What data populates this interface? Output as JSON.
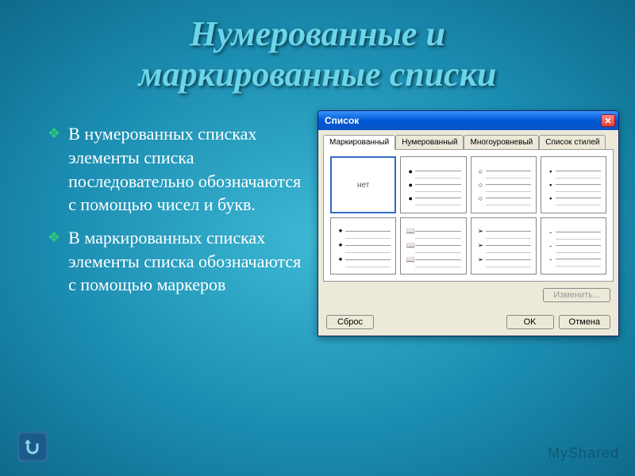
{
  "title_line1": "Нумерованные и",
  "title_line2": "маркированные списки",
  "bullets": [
    "В нумерованных списках элементы списка последовательно обозначаются с помощью чисел и букв.",
    "В маркированных списках элементы списка обозначаются с помощью маркеров"
  ],
  "dialog": {
    "title": "Список",
    "tabs": [
      "Маркированный",
      "Нумерованный",
      "Многоуровневый",
      "Список стилей"
    ],
    "active_tab": 0,
    "none_label": "нет",
    "cells": [
      {
        "type": "none"
      },
      {
        "type": "mark",
        "char": "●"
      },
      {
        "type": "mark",
        "char": "○"
      },
      {
        "type": "mark",
        "char": "▪"
      },
      {
        "type": "mark",
        "char": "✦"
      },
      {
        "type": "mark",
        "char": "📖"
      },
      {
        "type": "mark",
        "char": "➢"
      },
      {
        "type": "mark",
        "char": "-"
      }
    ],
    "buttons": {
      "change": "Изменить...",
      "reset": "Сброс",
      "ok": "OK",
      "cancel": "Отмена"
    }
  },
  "watermark": "MyShared"
}
